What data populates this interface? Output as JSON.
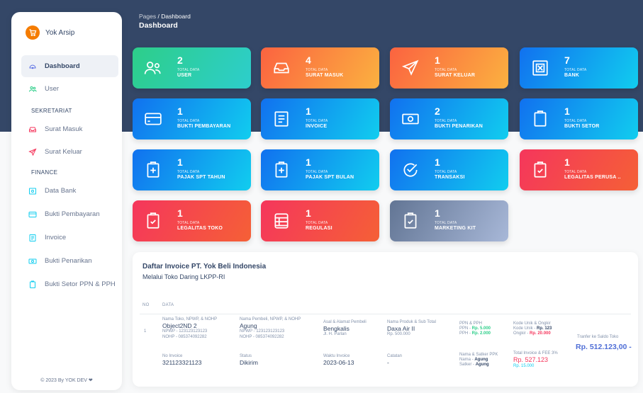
{
  "brand": {
    "name": "Yok Arsip"
  },
  "sidebar": {
    "items": [
      {
        "label": "Dashboard",
        "icon": "palette-icon"
      },
      {
        "label": "User",
        "icon": "users-icon"
      }
    ],
    "sections": [
      {
        "title": "SEKRETARIAT",
        "items": [
          {
            "label": "Surat Masuk"
          },
          {
            "label": "Surat Keluar"
          }
        ]
      },
      {
        "title": "FINANCE",
        "items": [
          {
            "label": "Data Bank"
          },
          {
            "label": "Bukti Pembayaran"
          },
          {
            "label": "Invoice"
          },
          {
            "label": "Bukti Penarikan"
          },
          {
            "label": "Bukti Setor PPN & PPH"
          }
        ]
      }
    ],
    "footer": "© 2023 By YOK DEV ❤"
  },
  "header": {
    "breadcrumb_root": "Pages",
    "breadcrumb_sep": "/",
    "breadcrumb_current": "Dashboard",
    "title": "Dashboard"
  },
  "cards": [
    {
      "value": "2",
      "sub": "TOTAL DATA",
      "label": "USER"
    },
    {
      "value": "4",
      "sub": "TOTAL DATA",
      "label": "SURAT MASUK"
    },
    {
      "value": "1",
      "sub": "TOTAL DATA",
      "label": "SURAT KELUAR"
    },
    {
      "value": "7",
      "sub": "TOTAL DATA",
      "label": "BANK"
    },
    {
      "value": "1",
      "sub": "TOTAL DATA",
      "label": "BUKTI PEMBAYARAN"
    },
    {
      "value": "1",
      "sub": "TOTAL DATA",
      "label": "INVOICE"
    },
    {
      "value": "2",
      "sub": "TOTAL DATA",
      "label": "BUKTI PENARIKAN"
    },
    {
      "value": "1",
      "sub": "TOTAL DATA",
      "label": "BUKTI SETOR"
    },
    {
      "value": "1",
      "sub": "TOTAL DATA",
      "label": "PAJAK SPT TAHUN"
    },
    {
      "value": "1",
      "sub": "TOTAL DATA",
      "label": "PAJAK SPT BULAN"
    },
    {
      "value": "1",
      "sub": "TOTAL DATA",
      "label": "TRANSAKSI"
    },
    {
      "value": "1",
      "sub": "TOTAL DATA",
      "label": "LEGALITAS PERUSA .."
    },
    {
      "value": "1",
      "sub": "TOTAL DATA",
      "label": "LEGALITAS TOKO"
    },
    {
      "value": "1",
      "sub": "TOTAL DATA",
      "label": "REGULASI"
    },
    {
      "value": "1",
      "sub": "TOTAL DATA",
      "label": "MARKETING KIT"
    }
  ],
  "invoice": {
    "title": "Daftar Invoice PT. Yok Beli Indonesia",
    "subtitle": "Melalui Toko Daring LKPP-RI",
    "headers": {
      "no": "NO",
      "data": "DATA"
    },
    "row": {
      "no": "1",
      "toko_label": "Nama Toko, NPWP, & NOHP",
      "toko_name": "Object2ND 2",
      "toko_npwp": "NPWP - 123123123123",
      "toko_nohp": "NOHP - 085374092282",
      "pembeli_label": "Nama Pembeli, NPWP, & NOHP",
      "pembeli_name": "Agung",
      "pembeli_npwp": "NPWP - 123123123123",
      "pembeli_nohp": "NOHP - 085374092282",
      "asal_label": "Asal & Alamat Pembeli",
      "asal_city": "Bengkalis",
      "asal_street": "Jl. H. Parlan",
      "produk_label": "Nama Produk & Sub Total",
      "produk_name": "Daxa Air II",
      "produk_price": "Rp. 500.000",
      "pajak_label": "PPN & PPH",
      "ppn_prefix": "PPN - ",
      "ppn_value": "Rp. 5.000",
      "pph_prefix": "PPH - ",
      "pph_value": "Rp. 2.000",
      "kode_label": "Kode Unik & Ongkir",
      "kode_prefix": "Kode Unik - ",
      "kode_value": "Rp. 123",
      "ongkir_prefix": "Ongkir - ",
      "ongkir_value": "Rp. 20.000",
      "transfer_label": "Tranfer ke Saldo Toko",
      "transfer_value": "Rp. 512.123,00 -",
      "noinv_label": "No Invoice",
      "noinv_value": "321123321123",
      "status_label": "Status",
      "status_value": "Dikirim",
      "waktu_label": "Waktu Invoice",
      "waktu_value": "2023-06-13",
      "catatan_label": "Catatan",
      "catatan_value": "-",
      "satker_label": "Nama & Satker PPK",
      "satker_name_prefix": "Nama - ",
      "satker_name": "Agung",
      "satker_prefix": "Satker - ",
      "satker_value": "Agung",
      "total_label": "Total Invoice & FEE 3%",
      "total_value": "Rp. 527.123",
      "fee_value": "Rp. 15.000"
    }
  },
  "colors": {
    "header_bg": "#344767",
    "accent": "#5e72e4"
  }
}
